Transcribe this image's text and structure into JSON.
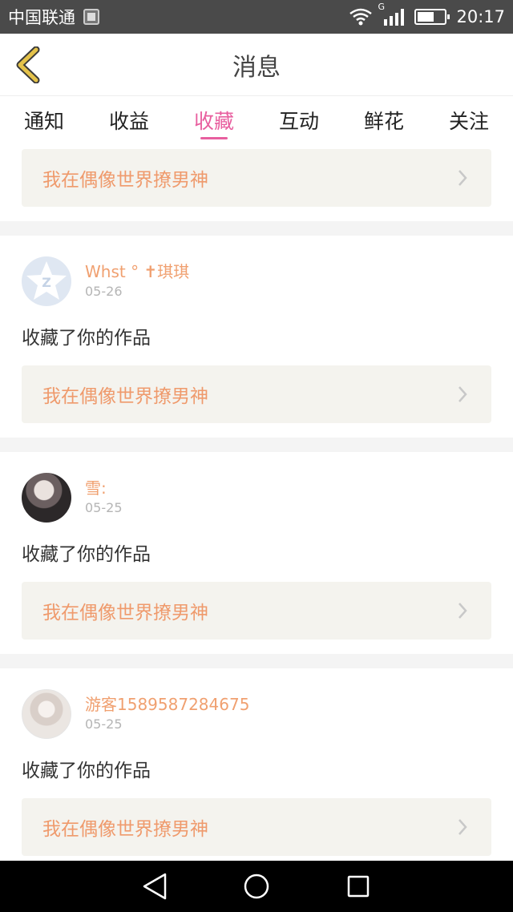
{
  "status_bar": {
    "carrier": "中国联通",
    "network": "G",
    "time": "20:17"
  },
  "header": {
    "title": "消息"
  },
  "tabs": [
    {
      "label": "通知",
      "active": false
    },
    {
      "label": "收益",
      "active": false
    },
    {
      "label": "收藏",
      "active": true
    },
    {
      "label": "互动",
      "active": false
    },
    {
      "label": "鲜花",
      "active": false
    },
    {
      "label": "关注",
      "active": false
    }
  ],
  "first_card": {
    "work_title": "我在偶像世界撩男神"
  },
  "items": [
    {
      "username": "Whst ° ✝琪琪",
      "date": "05-26",
      "action": "收藏了你的作品",
      "work_title": "我在偶像世界撩男神"
    },
    {
      "username": "雪:",
      "date": "05-25",
      "action": "收藏了你的作品",
      "work_title": "我在偶像世界撩男神"
    },
    {
      "username": "游客1589587284675",
      "date": "05-25",
      "action": "收藏了你的作品",
      "work_title": "我在偶像世界撩男神"
    }
  ],
  "colors": {
    "accent": "#e85f9f",
    "username": "#f0a070",
    "work_title": "#ef9a6c",
    "back_arrow": "#e4c24a"
  }
}
